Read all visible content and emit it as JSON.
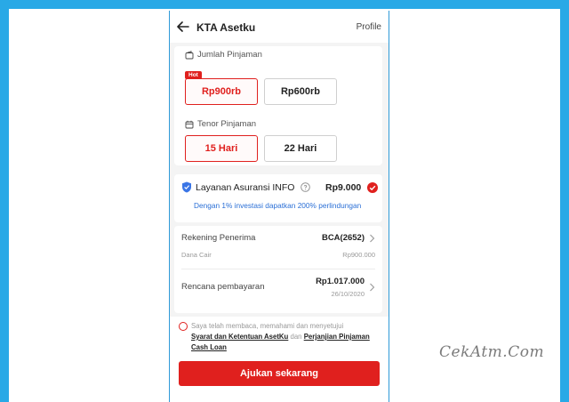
{
  "header": {
    "title": "KTA Asetku",
    "profile_label": "Profile"
  },
  "loan_amount": {
    "label": "Jumlah Pinjaman",
    "badge": "Hot",
    "options": [
      {
        "label": "Rp900rb",
        "selected": true
      },
      {
        "label": "Rp600rb",
        "selected": false
      }
    ]
  },
  "tenor": {
    "label": "Tenor Pinjaman",
    "options": [
      {
        "label": "15 Hari",
        "selected": true
      },
      {
        "label": "22 Hari",
        "selected": false
      }
    ]
  },
  "insurance": {
    "name": "Layanan Asuransi INFO",
    "price": "Rp9.000",
    "checked": true,
    "note": "Dengan 1% investasi dapatkan 200% perlindungan"
  },
  "details": {
    "account_label": "Rekening Penerima",
    "account_value": "BCA(2652)",
    "disbursed_label": "Dana Cair",
    "disbursed_value": "Rp900.000",
    "payment_label": "Rencana pembayaran",
    "payment_value": "Rp1.017.000",
    "payment_date": "26/10/2020"
  },
  "agreement": {
    "text_prefix": "Saya telah membaca, memahami dan menyetujui",
    "link1": "Syarat dan Ketentuan AsetKu",
    "conjunction": "dan",
    "link2": "Perjanjian Pinjaman Cash Loan"
  },
  "cta": {
    "label": "Ajukan sekarang"
  },
  "watermark": "CekAtm.Com",
  "colors": {
    "accent": "#e0201e",
    "background": "#29a9e6",
    "link_blue": "#2a6fd6"
  }
}
